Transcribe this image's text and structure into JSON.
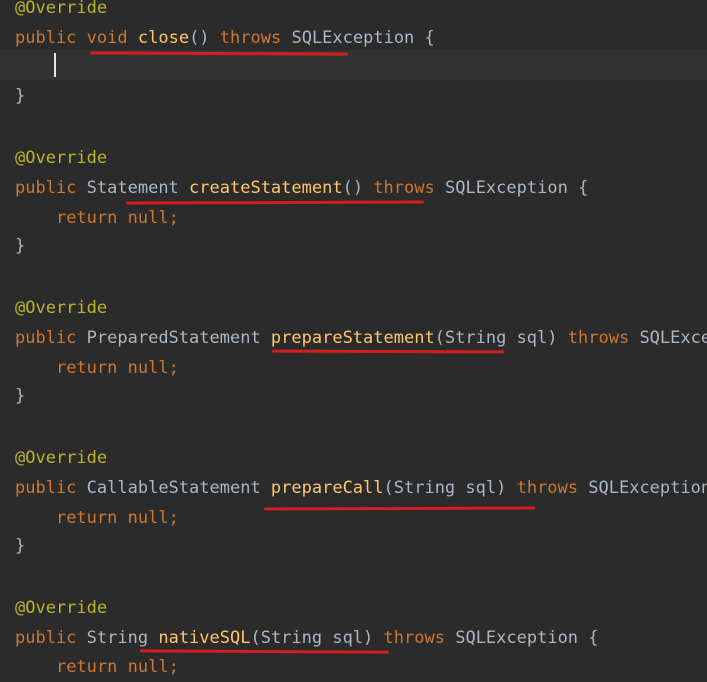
{
  "editor": {
    "m1": {
      "annotation": "@Override",
      "sig": {
        "public": "public",
        "ret": "void",
        "name": "close",
        "params": "()",
        "throws": "throws",
        "exc": "SQLException",
        "brace": "{"
      },
      "close": "}"
    },
    "m2": {
      "annotation": "@Override",
      "sig": {
        "public": "public",
        "ret": "Statement",
        "name": "createStatement",
        "params": "()",
        "throws": "throws",
        "exc": "SQLException",
        "brace": "{"
      },
      "body": {
        "ret": "return",
        "val": "null;"
      },
      "close": "}"
    },
    "m3": {
      "annotation": "@Override",
      "sig": {
        "public": "public",
        "ret": "PreparedStatement",
        "name": "prepareStatement",
        "params": "(String sql)",
        "throws": "throws",
        "exc": "SQLExcep"
      },
      "body": {
        "ret": "return",
        "val": "null;"
      },
      "close": "}"
    },
    "m4": {
      "annotation": "@Override",
      "sig": {
        "public": "public",
        "ret": "CallableStatement",
        "name": "prepareCall",
        "params": "(String sql)",
        "throws": "throws",
        "exc": "SQLException"
      },
      "body": {
        "ret": "return",
        "val": "null;"
      },
      "close": "}"
    },
    "m5": {
      "annotation": "@Override",
      "sig": {
        "public": "public",
        "ret": "String",
        "name": "nativeSQL",
        "params": "(String sql)",
        "throws": "throws",
        "exc": "SQLException",
        "brace": "{"
      },
      "body": {
        "ret": "return",
        "val": "null;"
      }
    },
    "colors": {
      "background": "#2b2b2b",
      "current_line": "#323232",
      "annotation": "#bbb529",
      "keyword": "#cc7832",
      "method": "#ffc66d",
      "plain": "#a9b7c6",
      "underline": "#d41f1f"
    }
  }
}
